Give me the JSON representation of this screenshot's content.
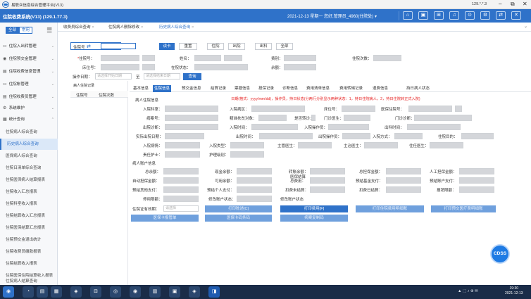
{
  "window": {
    "title": "易联众信息综合管理平台(V13)",
    "address": "129.*.*.3",
    "ctrl_min": "–",
    "ctrl_max": "⧉",
    "ctrl_close": "✕"
  },
  "header": {
    "system_name": "住院收费系统(V13) (129.1.77.3)",
    "user_info": "2021-12-13 星期一  您好,管理员_4960(住院处) ▾",
    "icons": [
      "⌂",
      "▣",
      "⊞",
      "♫",
      "⊙",
      "⚙",
      "⇄",
      "✕"
    ]
  },
  "sidebar": {
    "toggle_all": "全部",
    "toggle_common": "常用",
    "hamburger": "☰",
    "groups": [
      {
        "icon": "▭",
        "label": "住院入出转管理",
        "chev": "⌄"
      },
      {
        "icon": "◉",
        "label": "住院预交金管理",
        "chev": "⌄"
      },
      {
        "icon": "▤",
        "label": "住院收费信息管理",
        "chev": "⌄"
      },
      {
        "icon": "▭",
        "label": "住院帐管理",
        "chev": "⌄"
      },
      {
        "icon": "▤",
        "label": "住院收费员管理",
        "chev": "⌄"
      },
      {
        "icon": "⚙",
        "label": "系统维护",
        "chev": "⌄"
      },
      {
        "icon": "▦",
        "label": "统计查询",
        "chev": "⌃"
      }
    ],
    "items": [
      "住院病人综合查询",
      "历史病人综合查询",
      "医保病人综合查询",
      "住院日清单综合查询",
      "住院医保病人结算报表",
      "住院收入汇总报表",
      "住院科室收入报表",
      "住院结算收入汇总报表",
      "住院医保结算汇总报表",
      "住院预交金退出统计",
      "住院收费员缴款报表",
      "住院结算收入报表",
      "住院医保住院结算收入报表",
      "住院病人结算查询"
    ]
  },
  "page_tabs": [
    {
      "label": "收费员综合查询",
      "close": "×"
    },
    {
      "label": "住院病人删除修改",
      "close": "×"
    },
    {
      "label": "历史病人综合查询",
      "close": "×"
    }
  ],
  "page_tabs_chevron": "⌄",
  "search": {
    "field_label": "住院号",
    "swap_icon": "⇄",
    "value": ""
  },
  "toolbar": {
    "read_card": "读卡",
    "reset": "重置",
    "inpatient": "住院",
    "discharge": "出院",
    "transfer_out": "出科",
    "all": "全部"
  },
  "filters": {
    "inpatient_no": "住院号：",
    "name": "姓名：",
    "category": "费别：",
    "visit_count": "住院次数：",
    "bed_no": "床位号：",
    "in_status": "在院状态：",
    "balance": "余额："
  },
  "date_filter": {
    "label": "操作日期：",
    "start_placeholder": "请选择开始日期",
    "to": "至",
    "end_placeholder": "请选择结束日期",
    "query": "查询"
  },
  "left_list": {
    "title": "病人住院记录",
    "col_no": "住院号",
    "col_count": "住院次数"
  },
  "detail_tabs": [
    "基本信息",
    "住院信息",
    "预交金信息",
    "结算记录",
    "票据信息",
    "担保记录",
    "诊断信息",
    "费用清单信息",
    "费用转储记录",
    "退费信息"
  ],
  "patient_status_label": "持日病人状态",
  "inpatient_section": {
    "title": "病人住院信息",
    "notice": "日期(格式：yyyy/mm/dd)，操作员，持日状态(分两行分别显示两种状态：1，持日住院病人，2，持日住院转正式入院)",
    "ward": "入院科室：",
    "area": "入院病区：",
    "bed": "床位号：",
    "ins_no": "医保住院号：",
    "condition": "病案号：",
    "poverty": "精准扶贫对象：",
    "referral": "是否转诊：",
    "doctor": "门诊医生：",
    "diag_in": "入院诊断：",
    "admit_dx": "门诊诊断：",
    "admit_time_label": "出院诊断：",
    "in_time": "入院时间：",
    "in_op": "入院操作员：",
    "out_time": "出科时间：",
    "real_out": "实际出院日期：",
    "out_op_time": "出院时间：",
    "out_op": "出院操作员：",
    "in_way": "入院方式：",
    "in_purpose": "住院目的：",
    "in_condition": "入院病情：",
    "admit_type": "入院类型：",
    "chief_doctor": "主管医生：",
    "attending": "主治医生：",
    "resident": "住任医生：",
    "nurse": "责任护士：",
    "care_level": "护理级别："
  },
  "account_section": {
    "title": "病人账户信息",
    "total_balance": "总余额：",
    "cash_balance": "现金余额：",
    "transfer_balance": "转账余额：",
    "total_deposit": "总担保金额：",
    "manual_deposit": "人工担保金额：",
    "auto_deposit": "自动担保金额：",
    "available": "可用余额：",
    "medical_total": "医保结算\n总费用：",
    "fund_pay": "预结基金支付：",
    "personal_acc": "预结账户支付：",
    "cash_pay": "预结其他支付：",
    "personal_pay": "预结个人支付：",
    "unsettled": "扣费未结算：",
    "settled": "扣费已结算：",
    "report_amount": "报销限额：",
    "stop_balance": "停用限额：",
    "account_status": "修改账户状态：",
    "proof_valid": "住院证有效期：",
    "proof_placeholder": "请选择",
    "account_status2": "修改账户状态"
  },
  "actions": {
    "print_deposit": "打印陈述[C]",
    "print_bill": "打印费用[F]",
    "print_clinic_detail": "打印住院费用明细账",
    "print_deposit_detail": "打印预交医疗费明细账",
    "insurance_card": "医保卡报管单",
    "insurance_code": "医保卡码条码",
    "reprint_code": "病案复制码"
  },
  "cdss_label": "CDSS",
  "taskbar": {
    "icons": [
      "◉",
      "◔",
      "▤",
      "▦",
      "◈",
      "⊟",
      "◎",
      "◉",
      "▥",
      "▣",
      "◈",
      "◨"
    ],
    "tray": "▲ ⬚ ♪ ⊕ ✉",
    "time": "19:30",
    "date": "2021-12-13"
  }
}
